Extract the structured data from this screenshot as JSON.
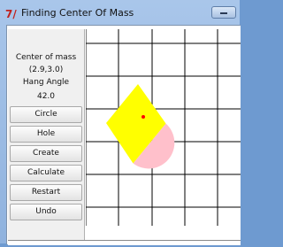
{
  "window": {
    "title": "Finding Center Of Mass",
    "app_icon": "7/"
  },
  "sidebar": {
    "center_label": "Center of mass",
    "center_value": "(2.9,3.0)",
    "angle_label": "Hang Angle",
    "angle_value": "42.0",
    "buttons": {
      "circle": "Circle",
      "hole": "Hole",
      "create": "Create",
      "calculate": "Calculate",
      "restart": "Restart",
      "undo": "Undo"
    }
  },
  "canvas": {
    "grid_lines": true,
    "shape_colors": {
      "rectangle": "#ffff00",
      "half_circle": "#ffc0cb",
      "center_marker": "#ff0000"
    },
    "grid_color": "#000000"
  }
}
